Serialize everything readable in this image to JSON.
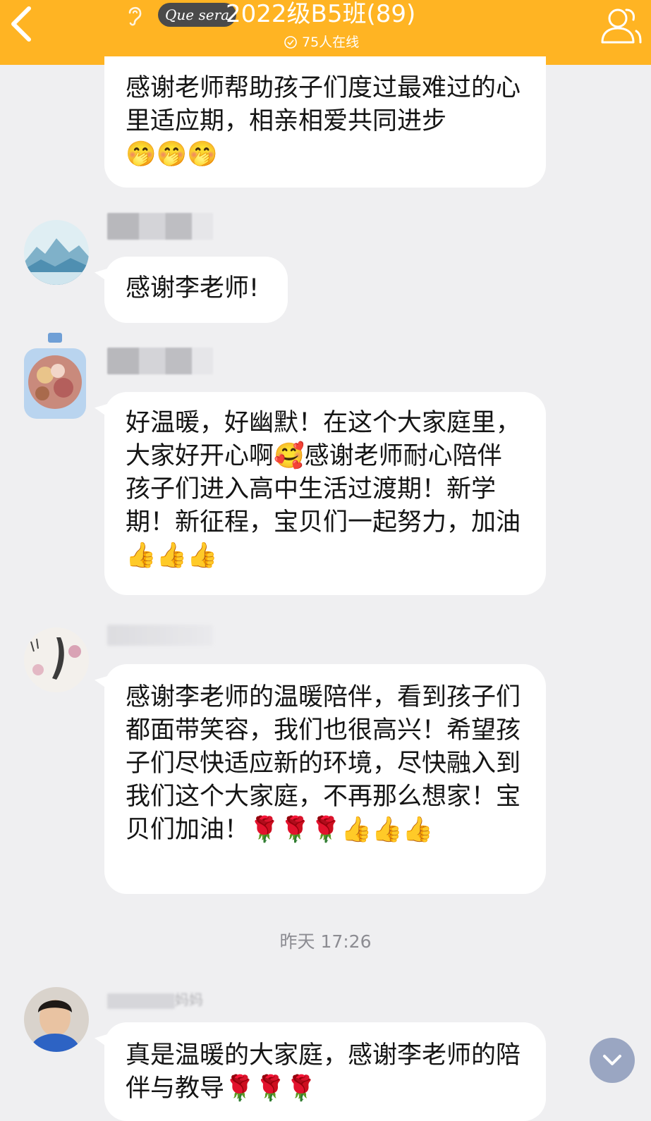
{
  "header": {
    "logo_text": "Que sera",
    "title": "2022级B5班(89)",
    "online_text": "75人在线",
    "bg_color": "#ffb423"
  },
  "messages": [
    {
      "id": "m1",
      "text": "感谢老师帮助孩子们度过最难过的心里适应期，相亲相爱共同进步",
      "emoji": "🤭🤭🤭"
    },
    {
      "id": "m2",
      "text": "感谢李老师!",
      "emoji": ""
    },
    {
      "id": "m3",
      "text": "好温暖，好幽默！在这个大家庭里，大家好开心啊",
      "emoji_inline": "🥰",
      "text_2": "感谢老师耐心陪伴孩子们进入高中生活过渡期！新学期！新征程，宝贝们一起努力，加油",
      "emoji": "👍👍👍"
    },
    {
      "id": "m4",
      "text": "感谢李老师的温暖陪伴，看到孩子们都面带笑容，我们也很高兴！希望孩子们尽快适应新的环境，尽快融入到我们这个大家庭，不再那么想家！宝贝们加油！",
      "emoji": "🌹🌹🌹👍👍👍"
    },
    {
      "id": "m5",
      "text": "真是温暖的大家庭，感谢李老师的陪伴与教导",
      "emoji": "🌹🌹🌹",
      "sender_suffix": "妈妈"
    }
  ],
  "timestamp": "昨天 17:26",
  "icons": {
    "back": "chevron-left-icon",
    "ear": "ear-icon",
    "members": "members-icon",
    "online": "check-circle-icon",
    "scroll": "chevron-down-icon"
  }
}
